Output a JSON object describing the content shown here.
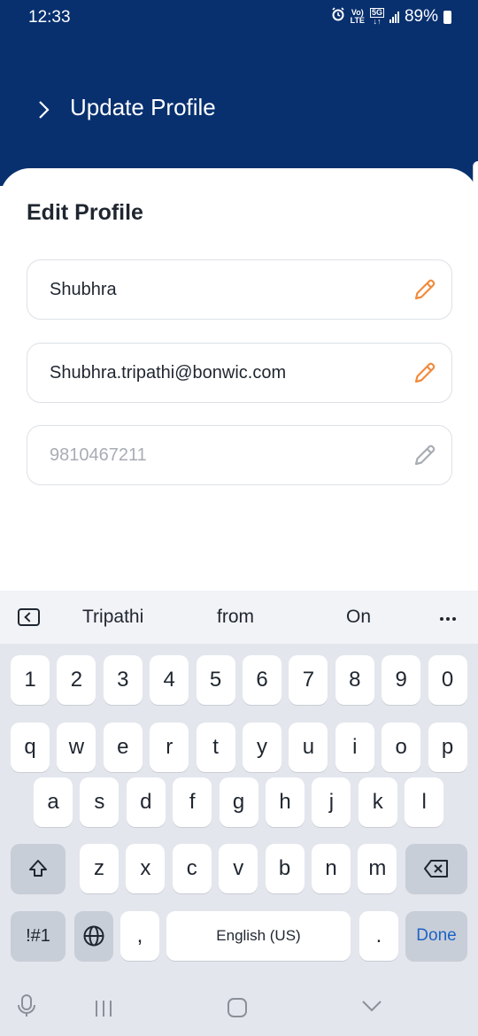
{
  "status": {
    "time": "12:33",
    "battery": "89%",
    "net_top": "Vo)",
    "net_bottom": "LTE",
    "gen": "5G"
  },
  "header": {
    "title": "Update Profile"
  },
  "form": {
    "title": "Edit Profile",
    "name": "Shubhra",
    "email": "Shubhra.tripathi@bonwic.com",
    "phone_placeholder": "9810467211"
  },
  "keyboard": {
    "suggestions": [
      "Tripathi",
      "from",
      "On"
    ],
    "number_row": [
      "1",
      "2",
      "3",
      "4",
      "5",
      "6",
      "7",
      "8",
      "9",
      "0"
    ],
    "row1": [
      "q",
      "w",
      "e",
      "r",
      "t",
      "y",
      "u",
      "i",
      "o",
      "p"
    ],
    "row2": [
      "a",
      "s",
      "d",
      "f",
      "g",
      "h",
      "j",
      "k",
      "l"
    ],
    "row3": [
      "z",
      "x",
      "c",
      "v",
      "b",
      "n",
      "m"
    ],
    "symbols_label": "!#1",
    "comma": ",",
    "space_label": "English (US)",
    "period": ".",
    "done_label": "Done"
  },
  "colors": {
    "header": "#08306f",
    "accent_pencil": "#f28a3c",
    "done": "#1e63c4"
  }
}
